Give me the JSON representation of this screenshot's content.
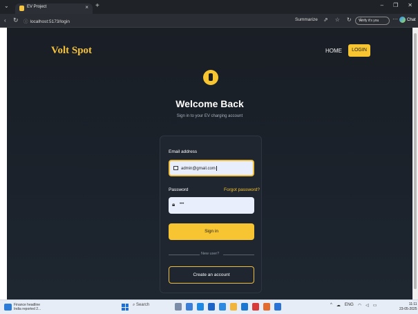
{
  "browser": {
    "tab_title": "EV Project",
    "tab_close": "×",
    "new_tab": "+",
    "url": "localhost:5173/login",
    "summarize": "Summarize",
    "profile": "Verify it's you",
    "chat": "Chat",
    "window_controls": [
      "–",
      "❐",
      "✕"
    ]
  },
  "header": {
    "brand": "Volt Spot",
    "nav_home": "HOME",
    "nav_login": "LOGIN"
  },
  "hero": {
    "title": "Welcome Back",
    "subtitle": "Sign in to your EV charging account"
  },
  "form": {
    "email_label": "Email address",
    "email_value": "admin@gmail.com",
    "password_label": "Password",
    "forgot_link": "Forgot password?",
    "password_value": "•••",
    "signin_label": "Sign in",
    "divider_text": "New user?",
    "create_label": "Create an account"
  },
  "taskbar": {
    "weather_line1": "Finance headline",
    "weather_line2": "India reported 2...",
    "search": "Search",
    "tray_lang": "ENG\nIN",
    "time": "11:11",
    "date": "23-05-2025"
  },
  "colors": {
    "accent": "#f7c531",
    "page_bg": "#1b222b",
    "card_bg": "#1f2630"
  }
}
